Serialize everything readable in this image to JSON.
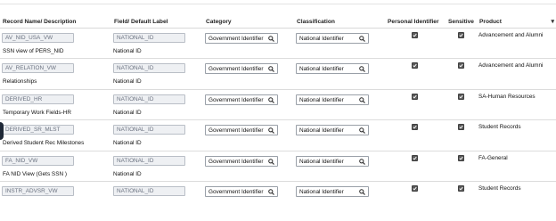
{
  "columns": {
    "record": "Record Name/ Description",
    "field": "Field/ Default Label",
    "category": "Category",
    "classification": "Classification",
    "personal": "Personal Identifier",
    "sensitive": "Sensitive",
    "product": "Product"
  },
  "rows": [
    {
      "record": "AV_NID_USA_VW",
      "description": "SSN view of PERS_NID",
      "field": "NATIONAL_ID",
      "label": "National ID",
      "category": "Government Identifier",
      "classification": "National Identifier",
      "personal": true,
      "sensitive": true,
      "product": "Advancement and Alumni"
    },
    {
      "record": "AV_RELATION_VW",
      "description": "Relationships",
      "field": "NATIONAL_ID",
      "label": "National ID",
      "category": "Government Identifier",
      "classification": "National Identifier",
      "personal": true,
      "sensitive": true,
      "product": "Advancement and Alumni"
    },
    {
      "record": "DERIVED_HR",
      "description": "Temporary Work Fields-HR",
      "field": "NATIONAL_ID",
      "label": "National ID",
      "category": "Government Identifier",
      "classification": "National Identifier",
      "personal": true,
      "sensitive": true,
      "product": "SA-Human Resources"
    },
    {
      "record": "DERIVED_SR_MLST",
      "description": "Derived Student Rec Milestones",
      "field": "NATIONAL_ID",
      "label": "National ID",
      "category": "Government Identifier",
      "classification": "National Identifier",
      "personal": true,
      "sensitive": true,
      "product": "Student Records"
    },
    {
      "record": "FA_NID_VW",
      "description": "FA NID View (Gets SSN )",
      "field": "NATIONAL_ID",
      "label": "National ID",
      "category": "Government Identifier",
      "classification": "National Identifier",
      "personal": true,
      "sensitive": true,
      "product": "FA-General"
    },
    {
      "record": "INSTR_ADVSR_VW",
      "description": "",
      "field": "NATIONAL_ID",
      "label": "",
      "category": "Government Identifier",
      "classification": "National Identifier",
      "personal": true,
      "sensitive": true,
      "product": "Student Records"
    }
  ],
  "icons": {
    "lookup": "search-icon",
    "checkbox": "checked-checkbox-icon",
    "column_menu": "chevron-down-icon"
  }
}
